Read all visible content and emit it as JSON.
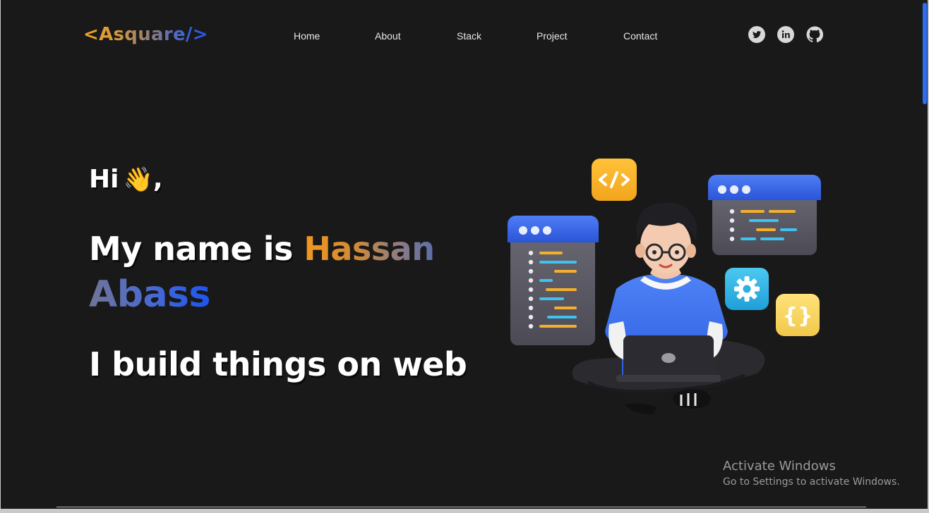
{
  "header": {
    "logo": "<Asquare/>",
    "nav": [
      {
        "label": "Home"
      },
      {
        "label": "About"
      },
      {
        "label": "Stack"
      },
      {
        "label": "Project"
      },
      {
        "label": "Contact"
      }
    ],
    "social": [
      {
        "icon": "twitter-icon"
      },
      {
        "icon": "linkedin-icon"
      },
      {
        "icon": "github-icon"
      }
    ]
  },
  "hero": {
    "greeting": "Hi",
    "wave_emoji": "👋",
    "greeting_suffix": ",",
    "name_prefix": "My name is",
    "first_name": "Hassan",
    "last_name": "Abass",
    "tagline": "I build things on web"
  },
  "watermark": {
    "title": "Activate Windows",
    "subtitle": "Go to Settings to activate Windows."
  },
  "colors": {
    "background": "#191919",
    "accent_orange": "#f2971e",
    "accent_blue": "#1d55f0"
  }
}
